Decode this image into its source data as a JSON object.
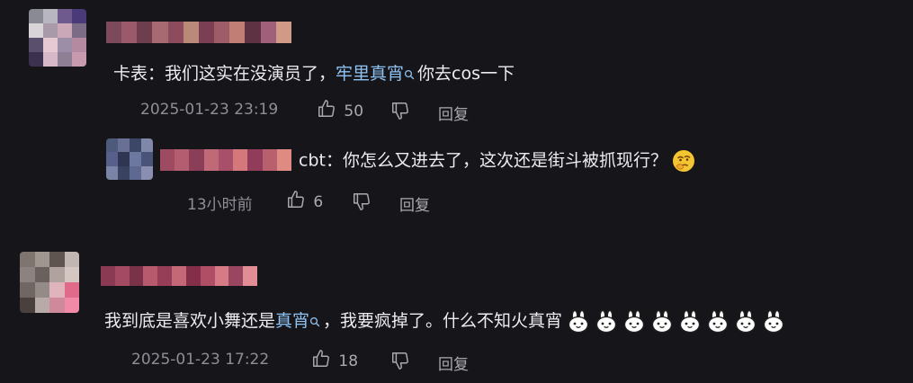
{
  "comments": [
    {
      "prefix": "卡表：我们这实在没演员了，",
      "mention": "牢里真宵",
      "suffix": "你去cos一下",
      "timestamp": "2025-01-23 23:19",
      "likes": "50",
      "reply_label": "回复"
    },
    {
      "prefix": "cbt：你怎么又进去了，这次还是街斗被抓现行？",
      "timestamp": "13小时前",
      "likes": "6",
      "reply_label": "回复",
      "emoji": "thinking-face-emoji"
    },
    {
      "prefix": "我到底是喜欢小舞还是",
      "mention": "真宵",
      "suffix": "，我要疯掉了。什么不知火真宵",
      "timestamp": "2025-01-23 17:22",
      "likes": "18",
      "reply_label": "回复",
      "emoji": "bunny-emoji",
      "emoji_count": 8
    }
  ],
  "colors": {
    "background": "#16161a",
    "text": "#ececf0",
    "mention": "#8ec2f2",
    "meta": "#8e8e96"
  }
}
